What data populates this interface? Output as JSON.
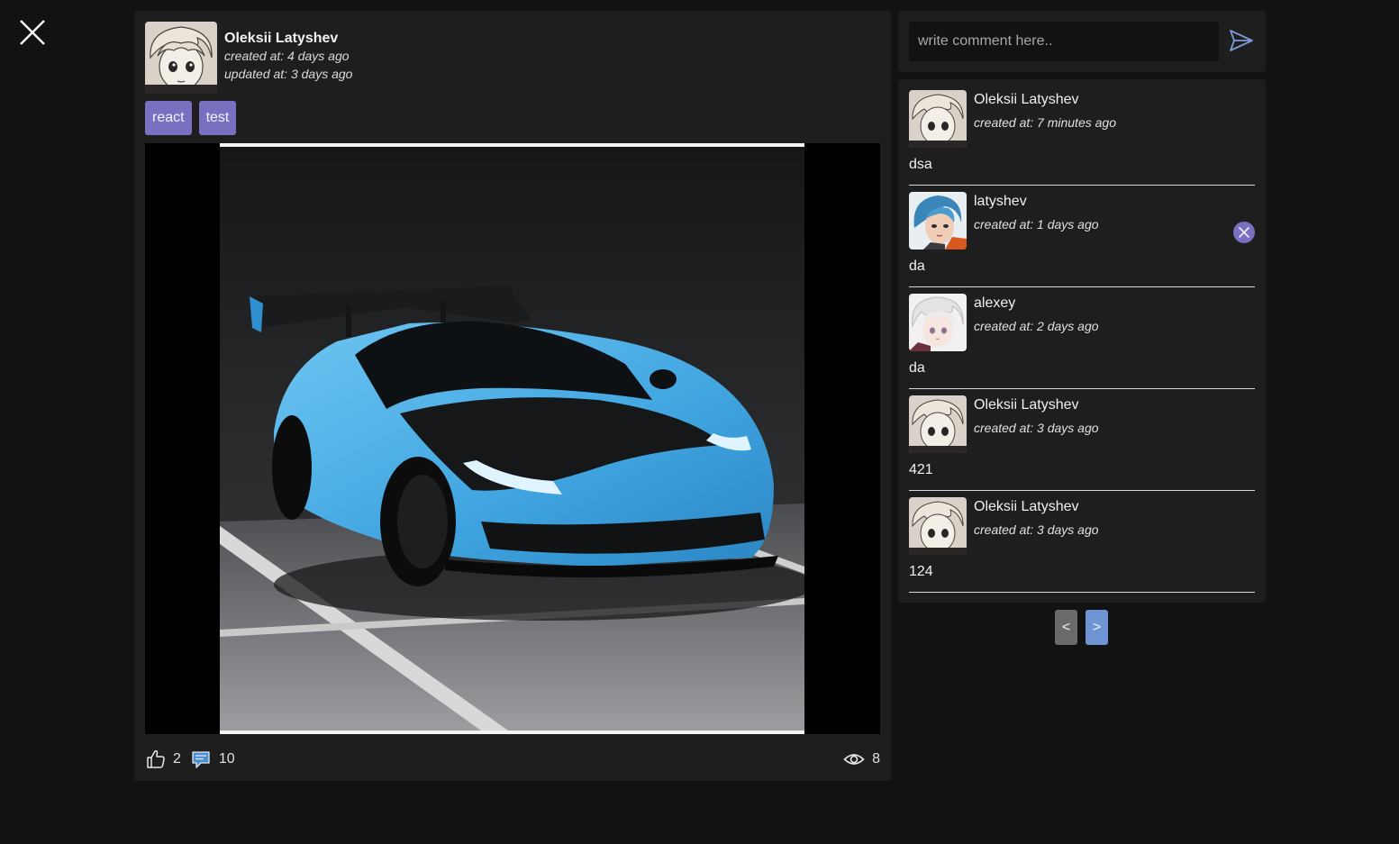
{
  "close_icon": "close-icon",
  "post": {
    "author": "Oleksii Latyshev",
    "created": "created at: 4 days ago",
    "updated": "updated at: 3 days ago",
    "tags": [
      "react",
      "test"
    ],
    "likes": "2",
    "comments_count": "10",
    "views": "8"
  },
  "comment_form": {
    "placeholder": "write comment here.."
  },
  "comments": [
    {
      "user": "Oleksii Latyshev",
      "date": "created at: 7 minutes ago",
      "text": "dsa",
      "avatar": "white-hair"
    },
    {
      "user": "latyshev",
      "date": "created at: 1 days ago",
      "text": "da",
      "avatar": "blue-hair",
      "deletable": true
    },
    {
      "user": "alexey",
      "date": "created at: 2 days ago",
      "text": "da",
      "avatar": "white-hair-light"
    },
    {
      "user": "Oleksii Latyshev",
      "date": "created at: 3 days ago",
      "text": "421",
      "avatar": "white-hair"
    },
    {
      "user": "Oleksii Latyshev",
      "date": "created at: 3 days ago",
      "text": "124",
      "avatar": "white-hair"
    }
  ],
  "pager": {
    "prev": "<",
    "next": ">"
  },
  "colors": {
    "tag": "#7a70c2",
    "delete": "#7a70c2",
    "pager_next": "#6f94d4",
    "pager_prev": "#6a6a6a",
    "car": "#3fa4e0"
  }
}
